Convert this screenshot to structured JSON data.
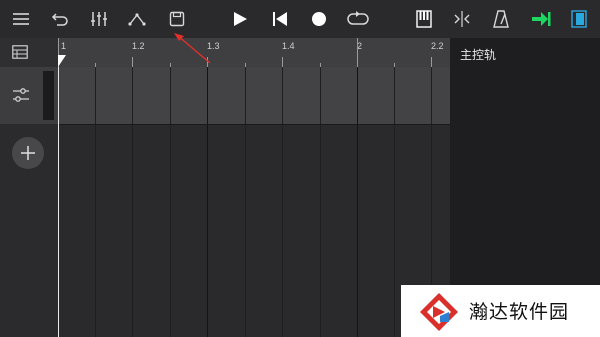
{
  "toolbar": {
    "icons": [
      "menu-icon",
      "undo-icon",
      "mixer-icon",
      "automation-icon",
      "save-icon",
      "play-icon",
      "skip-back-icon",
      "record-icon",
      "loop-icon",
      "keyboard-icon",
      "split-icon",
      "metronome-icon",
      "export-icon",
      "panel-toggle-icon"
    ],
    "accent_green": "#1ed760",
    "accent_blue": "#2aa8e0"
  },
  "ruler": {
    "labels": [
      "1",
      "1.2",
      "1.3",
      "1.4",
      "2",
      "2.2"
    ]
  },
  "right_panel": {
    "title": "主控轨"
  },
  "watermark": {
    "text": "瀚达软件园",
    "logo_color": "#d9302c"
  },
  "annotation": {
    "arrow_color": "#e0302a"
  }
}
